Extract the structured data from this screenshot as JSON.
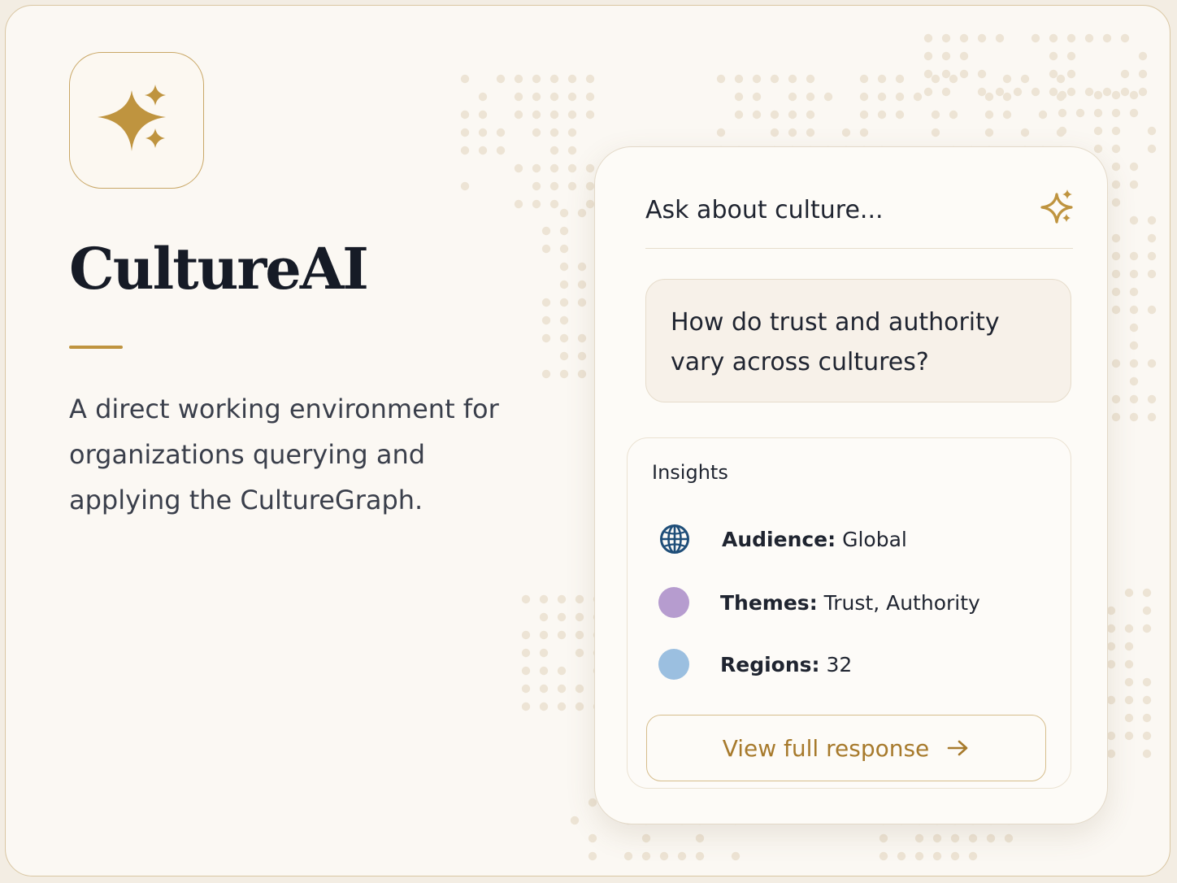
{
  "brand": {
    "name": "CultureAI",
    "description": "A direct working environment for organizations querying and applying the CultureGraph.",
    "logo_icon": "sparkles-icon"
  },
  "assistant": {
    "placeholder": "Ask about culture...",
    "sparkle_icon": "sparkles-icon",
    "question": "How do trust and authority vary across cultures?",
    "insights": {
      "title": "Insights",
      "items": [
        {
          "label": "Audience:",
          "value": "Global",
          "icon": "globe-icon",
          "color": "#1f4e79"
        },
        {
          "label": "Themes:",
          "value": "Trust, Authority",
          "icon": "purple-dot-icon",
          "color": "#b69ccf"
        },
        {
          "label": "Regions:",
          "value": "32",
          "icon": "blue-dot-icon",
          "color": "#9bbfe0"
        }
      ]
    },
    "view_button": {
      "label": "View full response",
      "icon": "arrow-right-icon"
    }
  },
  "colors": {
    "accent": "#bf943f",
    "title": "#161b26",
    "background": "#fbf8f3"
  }
}
